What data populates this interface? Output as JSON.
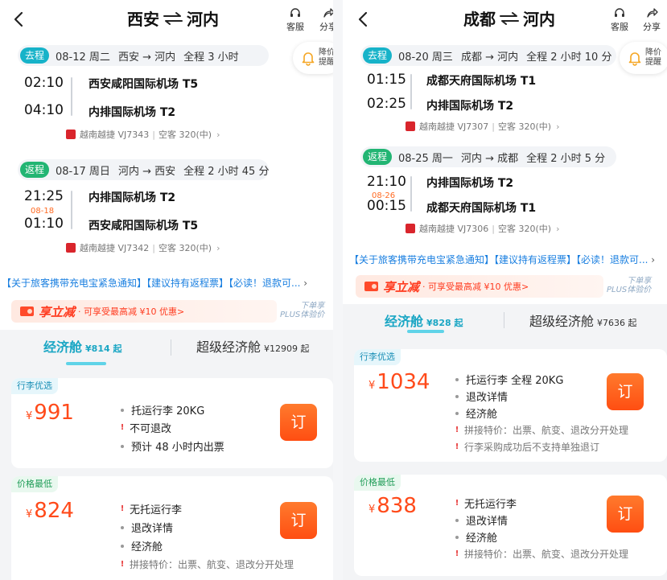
{
  "header_common": {
    "service_label": "客服",
    "share_label": "分享",
    "alert_line1": "降价",
    "alert_line2": "提醒"
  },
  "left": {
    "origin": "西安",
    "destination": "河内",
    "outbound": {
      "tag": "去程",
      "date": "08-12 周二",
      "route": "西安 → 河内",
      "duration": "全程 3 小时",
      "dep_time": "02:10",
      "dep_airport": "西安咸阳国际机场 T5",
      "arr_time": "04:10",
      "arr_airport": "内排国际机场 T2",
      "airline": "越南越捷 VJ7343",
      "aircraft": "空客 320(中)"
    },
    "inbound": {
      "tag": "返程",
      "date": "08-17 周日",
      "route": "河内 → 西安",
      "duration": "全程 2 小时 45 分",
      "dep_time": "21:25",
      "dep_airport": "内排国际机场 T2",
      "arr_date": "08-18",
      "arr_time": "01:10",
      "arr_airport": "西安咸阳国际机场 T5",
      "airline": "越南越捷 VJ7342",
      "aircraft": "空客 320(中)"
    },
    "notice": "【关于旅客携带充电宝紧急通知】【建议持有返程票】【必读！退款可...",
    "promo_title": "享立减",
    "promo_sub": "· 可享受最高减 ¥10 优惠>",
    "plus_line1": "下单享",
    "plus_line2": "PLUS体验价",
    "tab_economy": "经济舱",
    "tab_economy_price": "¥814 起",
    "tab_super": "超级经济舱",
    "tab_super_price": "¥12909 起",
    "card1": {
      "badge": "行李优选",
      "currency": "¥",
      "price": "991",
      "f1": "托运行李 20KG",
      "f2": "不可退改",
      "f3": "预计 48 小时内出票",
      "book": "订"
    },
    "card2": {
      "badge": "价格最低",
      "currency": "¥",
      "price": "824",
      "f1": "无托运行李",
      "f2": "退改详情",
      "f3": "经济舱",
      "f4": "拼接特价：出票、航变、退改分开处理",
      "book": "订"
    }
  },
  "right": {
    "origin": "成都",
    "destination": "河内",
    "outbound": {
      "tag": "去程",
      "date": "08-20 周三",
      "route": "成都 → 河内",
      "duration": "全程 2 小时 10 分",
      "dep_time": "01:15",
      "dep_airport": "成都天府国际机场 T1",
      "arr_time": "02:25",
      "arr_airport": "内排国际机场 T2",
      "airline": "越南越捷 VJ7307",
      "aircraft": "空客 320(中)"
    },
    "inbound": {
      "tag": "返程",
      "date": "08-25 周一",
      "route": "河内 → 成都",
      "duration": "全程 2 小时 5 分",
      "dep_time": "21:10",
      "dep_airport": "内排国际机场 T2",
      "arr_date": "08-26",
      "arr_time": "00:15",
      "arr_airport": "成都天府国际机场 T1",
      "airline": "越南越捷 VJ7306",
      "aircraft": "空客 320(中)"
    },
    "notice": "【关于旅客携带充电宝紧急通知】【建议持有返程票】【必读！退款可...",
    "promo_title": "享立减",
    "promo_sub": "· 可享受最高减 ¥10 优惠>",
    "plus_line1": "下单享",
    "plus_line2": "PLUS体验价",
    "tab_economy": "经济舱",
    "tab_economy_price": "¥828 起",
    "tab_super": "超级经济舱",
    "tab_super_price": "¥7636 起",
    "card1": {
      "badge": "行李优选",
      "currency": "¥",
      "price": "1034",
      "f1": "托运行李 全程 20KG",
      "f2": "退改详情",
      "f3": "经济舱",
      "f4": "拼接特价：出票、航变、退改分开处理",
      "f5": "行李采购成功后不支持单独退订",
      "book": "订"
    },
    "card2": {
      "badge": "价格最低",
      "currency": "¥",
      "price": "838",
      "f1": "无托运行李",
      "f2": "退改详情",
      "f3": "经济舱",
      "f4": "拼接特价：出票、航变、退改分开处理",
      "book": "订"
    }
  },
  "colors": {
    "accent": "#1aa6c4",
    "price": "#ff4a1a",
    "notice": "#1a7fe0",
    "outbound_tag": "#17b3c9",
    "inbound_tag": "#22b573"
  }
}
